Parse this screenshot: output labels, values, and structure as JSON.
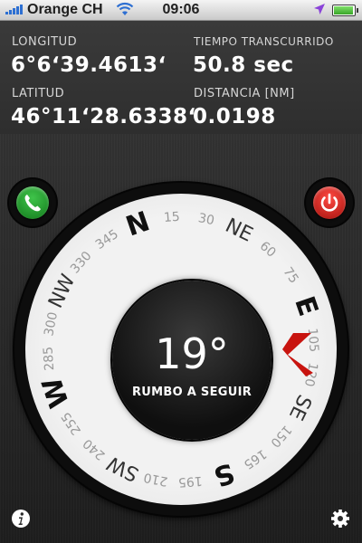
{
  "status_bar": {
    "carrier": "Orange CH",
    "time": "09:06",
    "battery_level": 0.95
  },
  "info": {
    "longitude_label": "LONGITUD",
    "longitude_value": "6°6ʻ39.4613ʻ",
    "latitude_label": "LATITUD",
    "latitude_value": "46°11ʻ28.6338ʻ",
    "elapsed_label": "TIEMPO TRANSCURRIDO",
    "elapsed_value": "50.8 sec",
    "distance_label": "DISTANCIA [NM]",
    "distance_value": "0.0198"
  },
  "compass": {
    "heading": "19°",
    "heading_caption": "RUMBO A SEGUIR",
    "rotation_deg": -19,
    "marker_bearing_deg": 19,
    "marks": [
      {
        "label": "N",
        "deg": 0,
        "cardinal": true
      },
      {
        "label": "15",
        "deg": 15
      },
      {
        "label": "30",
        "deg": 30
      },
      {
        "label": "NE",
        "deg": 45,
        "inter": true
      },
      {
        "label": "60",
        "deg": 60
      },
      {
        "label": "75",
        "deg": 75
      },
      {
        "label": "E",
        "deg": 90,
        "cardinal": true
      },
      {
        "label": "105",
        "deg": 105
      },
      {
        "label": "120",
        "deg": 120
      },
      {
        "label": "SE",
        "deg": 135,
        "inter": true
      },
      {
        "label": "150",
        "deg": 150
      },
      {
        "label": "165",
        "deg": 165
      },
      {
        "label": "S",
        "deg": 180,
        "cardinal": true
      },
      {
        "label": "195",
        "deg": 195
      },
      {
        "label": "210",
        "deg": 210
      },
      {
        "label": "SW",
        "deg": 225,
        "inter": true
      },
      {
        "label": "240",
        "deg": 240
      },
      {
        "label": "255",
        "deg": 255
      },
      {
        "label": "W",
        "deg": 270,
        "cardinal": true
      },
      {
        "label": "285",
        "deg": 285
      },
      {
        "label": "300",
        "deg": 300
      },
      {
        "label": "NW",
        "deg": 315,
        "inter": true
      },
      {
        "label": "330",
        "deg": 330
      },
      {
        "label": "345",
        "deg": 345
      }
    ]
  },
  "icons": {
    "phone": "phone-icon",
    "power": "power-icon",
    "info": "info-icon",
    "settings": "gear-icon"
  },
  "colors": {
    "call_green": "#1f9a28",
    "power_red": "#d9201a",
    "marker_red": "#c8140f",
    "ring": "#efefef",
    "background": "#2b2b2b"
  }
}
